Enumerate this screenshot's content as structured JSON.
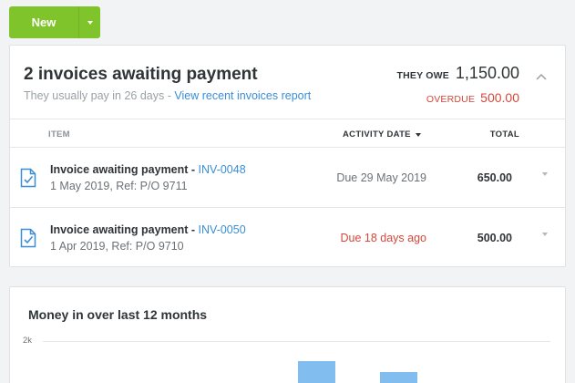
{
  "toolbar": {
    "new_label": "New"
  },
  "summary": {
    "title": "2 invoices awaiting payment",
    "usually_pay": "They usually pay in 26 days",
    "separator": "-",
    "report_link": "View recent invoices report",
    "they_owe_label": "THEY OWE",
    "they_owe_amount": "1,150.00",
    "overdue_label": "OVERDUE",
    "overdue_amount": "500.00"
  },
  "table": {
    "columns": {
      "item": "ITEM",
      "activity_date": "ACTIVITY DATE",
      "total": "TOTAL"
    },
    "rows": [
      {
        "title": "Invoice awaiting payment - ",
        "number": "INV-0048",
        "detail": "1 May 2019, Ref: P/O 9711",
        "date": "Due 29 May 2019",
        "overdue": false,
        "total": "650.00"
      },
      {
        "title": "Invoice awaiting payment - ",
        "number": "INV-0050",
        "detail": "1 Apr 2019, Ref: P/O 9710",
        "date": "Due 18 days ago",
        "overdue": true,
        "total": "500.00"
      }
    ]
  },
  "money_in": {
    "title": "Money in over last 12 months",
    "tick_label": "2k"
  },
  "colors": {
    "accent_green": "#7fc42b",
    "link_blue": "#3a8ed8",
    "overdue_red": "#d5473a",
    "bar_blue": "#82bdf0"
  }
}
